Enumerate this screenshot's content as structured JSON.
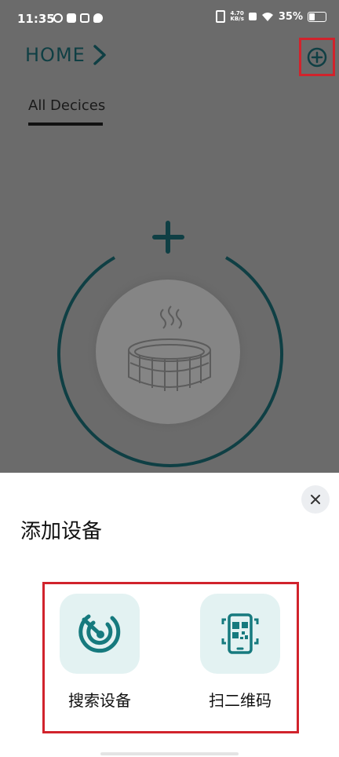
{
  "status_bar": {
    "time": "11:35",
    "net_speed_value": "4.70",
    "net_speed_unit": "KB/s",
    "battery": "35%"
  },
  "header": {
    "title": "HOME",
    "tab_label": "All Decices"
  },
  "device_graphic": {
    "icon": "hot-tub-icon",
    "accent_color": "#0f3f44"
  },
  "sheet": {
    "title": "添加设备",
    "options": [
      {
        "label": "搜索设备",
        "icon": "radar-search-icon"
      },
      {
        "label": "扫二维码",
        "icon": "qr-scan-icon"
      }
    ],
    "icon_bg_color": "#e3f2f2",
    "icon_color": "#167a7e",
    "highlight_color": "#d1232c"
  }
}
